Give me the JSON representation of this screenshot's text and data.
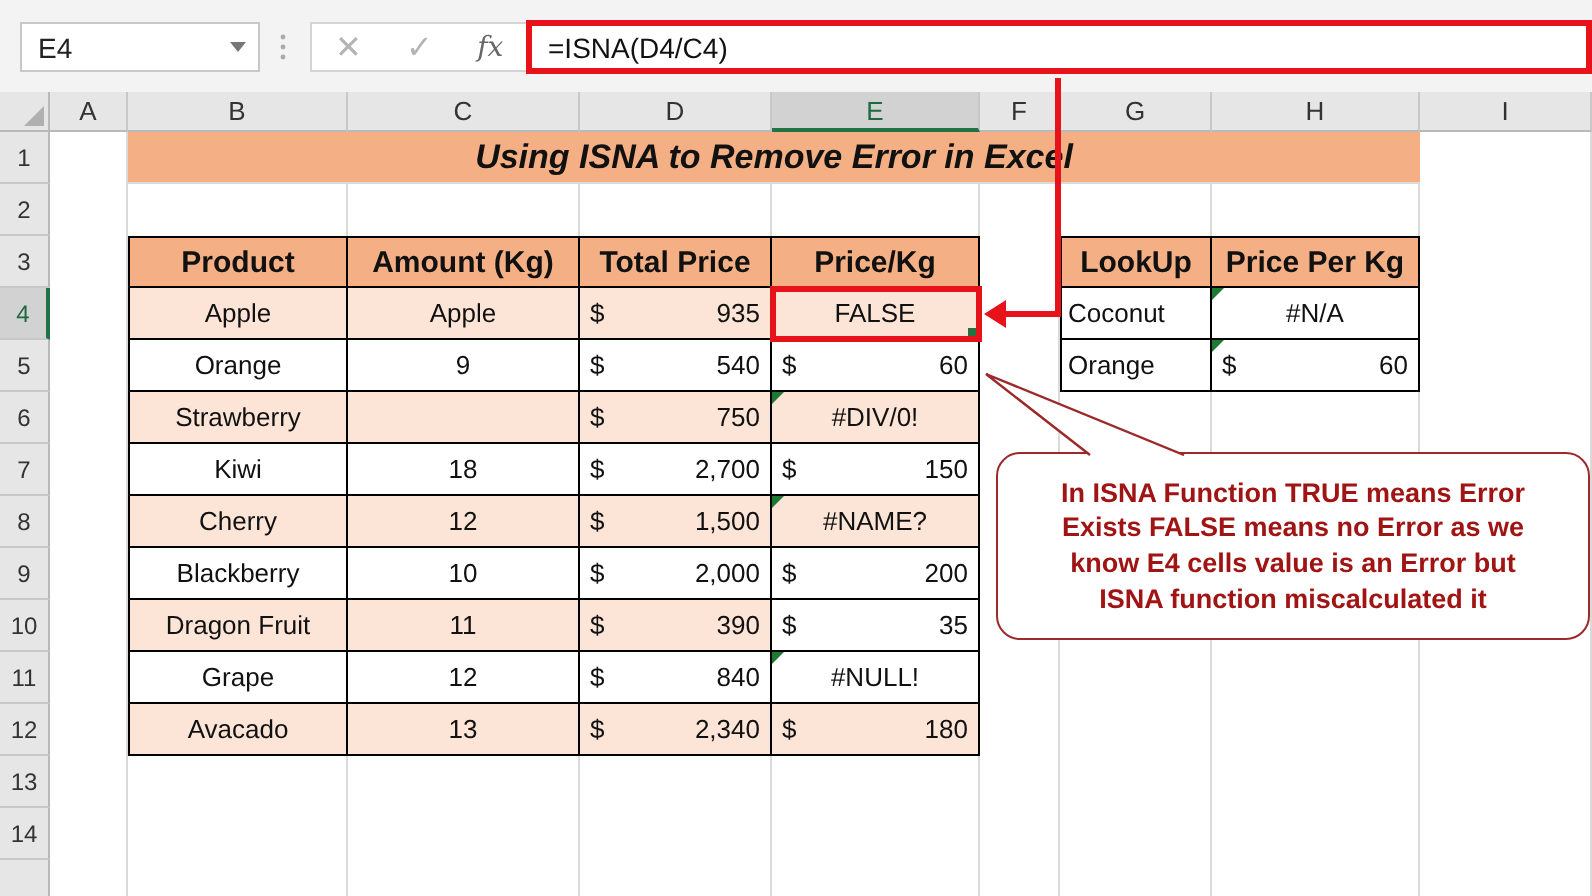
{
  "name_box": {
    "value": "E4"
  },
  "formula_bar": {
    "cancel": "✕",
    "enter": "✓",
    "function": "fx",
    "formula": "=ISNA(D4/C4)",
    "highlighted": true
  },
  "column_headers": [
    {
      "label": "A",
      "selected": false
    },
    {
      "label": "B",
      "selected": false
    },
    {
      "label": "C",
      "selected": false
    },
    {
      "label": "D",
      "selected": false
    },
    {
      "label": "E",
      "selected": true
    },
    {
      "label": "F",
      "selected": false
    },
    {
      "label": "G",
      "selected": false
    },
    {
      "label": "H",
      "selected": false
    },
    {
      "label": "I",
      "selected": false
    }
  ],
  "row_headers": [
    {
      "label": "1",
      "selected": false
    },
    {
      "label": "2",
      "selected": false
    },
    {
      "label": "3",
      "selected": false
    },
    {
      "label": "4",
      "selected": true
    },
    {
      "label": "5",
      "selected": false
    },
    {
      "label": "6",
      "selected": false
    },
    {
      "label": "7",
      "selected": false
    },
    {
      "label": "8",
      "selected": false
    },
    {
      "label": "9",
      "selected": false
    },
    {
      "label": "10",
      "selected": false
    },
    {
      "label": "11",
      "selected": false
    },
    {
      "label": "12",
      "selected": false
    },
    {
      "label": "13",
      "selected": false
    },
    {
      "label": "14",
      "selected": false
    }
  ],
  "title": "Using ISNA to Remove Error in Excel",
  "main_table": {
    "columns": [
      "Product",
      "Amount (Kg)",
      "Total Price",
      "Price/Kg"
    ],
    "rows": [
      {
        "cells": [
          {
            "kind": "text",
            "text": "Apple",
            "shaded": true,
            "flag": false,
            "selected": false
          },
          {
            "kind": "text",
            "text": "Apple",
            "shaded": true,
            "flag": false,
            "selected": false
          },
          {
            "kind": "currency",
            "symbol": "$",
            "text": "935",
            "shaded": true,
            "flag": false,
            "selected": false
          },
          {
            "kind": "text",
            "text": "FALSE",
            "shaded": true,
            "flag": false,
            "selected": true
          }
        ]
      },
      {
        "cells": [
          {
            "kind": "text",
            "text": "Orange",
            "shaded": false,
            "flag": false,
            "selected": false
          },
          {
            "kind": "text",
            "text": "9",
            "shaded": false,
            "flag": false,
            "selected": false
          },
          {
            "kind": "currency",
            "symbol": "$",
            "text": "540",
            "shaded": false,
            "flag": false,
            "selected": false
          },
          {
            "kind": "currency",
            "symbol": "$",
            "text": "60",
            "shaded": false,
            "flag": false,
            "selected": false
          }
        ]
      },
      {
        "cells": [
          {
            "kind": "text",
            "text": "Strawberry",
            "shaded": true,
            "flag": false,
            "selected": false
          },
          {
            "kind": "blank",
            "shaded": true,
            "flag": false,
            "selected": false
          },
          {
            "kind": "currency",
            "symbol": "$",
            "text": "750",
            "shaded": true,
            "flag": false,
            "selected": false
          },
          {
            "kind": "text",
            "text": "#DIV/0!",
            "shaded": true,
            "flag": true,
            "selected": false
          }
        ]
      },
      {
        "cells": [
          {
            "kind": "text",
            "text": "Kiwi",
            "shaded": false,
            "flag": false,
            "selected": false
          },
          {
            "kind": "text",
            "text": "18",
            "shaded": false,
            "flag": false,
            "selected": false
          },
          {
            "kind": "currency",
            "symbol": "$",
            "text": "2,700",
            "shaded": false,
            "flag": false,
            "selected": false
          },
          {
            "kind": "currency",
            "symbol": "$",
            "text": "150",
            "shaded": false,
            "flag": false,
            "selected": false
          }
        ]
      },
      {
        "cells": [
          {
            "kind": "text",
            "text": "Cherry",
            "shaded": true,
            "flag": false,
            "selected": false
          },
          {
            "kind": "text",
            "text": "12",
            "shaded": true,
            "flag": false,
            "selected": false
          },
          {
            "kind": "currency",
            "symbol": "$",
            "text": "1,500",
            "shaded": true,
            "flag": false,
            "selected": false
          },
          {
            "kind": "text",
            "text": "#NAME?",
            "shaded": true,
            "flag": true,
            "selected": false
          }
        ]
      },
      {
        "cells": [
          {
            "kind": "text",
            "text": "Blackberry",
            "shaded": false,
            "flag": false,
            "selected": false
          },
          {
            "kind": "text",
            "text": "10",
            "shaded": false,
            "flag": false,
            "selected": false
          },
          {
            "kind": "currency",
            "symbol": "$",
            "text": "2,000",
            "shaded": false,
            "flag": false,
            "selected": false
          },
          {
            "kind": "currency",
            "symbol": "$",
            "text": "200",
            "shaded": false,
            "flag": false,
            "selected": false
          }
        ]
      },
      {
        "cells": [
          {
            "kind": "text",
            "text": "Dragon Fruit",
            "shaded": true,
            "flag": false,
            "selected": false
          },
          {
            "kind": "text",
            "text": "11",
            "shaded": true,
            "flag": false,
            "selected": false
          },
          {
            "kind": "currency",
            "symbol": "$",
            "text": "390",
            "shaded": true,
            "flag": false,
            "selected": false
          },
          {
            "kind": "currency",
            "symbol": "$",
            "text": "35",
            "shaded": false,
            "flag": false,
            "selected": false
          }
        ]
      },
      {
        "cells": [
          {
            "kind": "text",
            "text": "Grape",
            "shaded": false,
            "flag": false,
            "selected": false
          },
          {
            "kind": "text",
            "text": "12",
            "shaded": false,
            "flag": false,
            "selected": false
          },
          {
            "kind": "currency",
            "symbol": "$",
            "text": "840",
            "shaded": false,
            "flag": false,
            "selected": false
          },
          {
            "kind": "text",
            "text": "#NULL!",
            "shaded": false,
            "flag": true,
            "selected": false
          }
        ]
      },
      {
        "cells": [
          {
            "kind": "text",
            "text": "Avacado",
            "shaded": true,
            "flag": false,
            "selected": false
          },
          {
            "kind": "text",
            "text": "13",
            "shaded": true,
            "flag": false,
            "selected": false
          },
          {
            "kind": "currency",
            "symbol": "$",
            "text": "2,340",
            "shaded": true,
            "flag": false,
            "selected": false
          },
          {
            "kind": "currency",
            "symbol": "$",
            "text": "180",
            "shaded": true,
            "flag": false,
            "selected": false
          }
        ]
      }
    ]
  },
  "lookup_table": {
    "columns": [
      "LookUp",
      "Price Per Kg"
    ],
    "rows": [
      {
        "cells": [
          {
            "kind": "label",
            "text": "Coconut",
            "shaded": false,
            "flag": false,
            "selected": false
          },
          {
            "kind": "text",
            "text": "#N/A",
            "shaded": false,
            "flag": true,
            "selected": false
          }
        ]
      },
      {
        "cells": [
          {
            "kind": "label",
            "text": "Orange",
            "shaded": false,
            "flag": false,
            "selected": false
          },
          {
            "kind": "currency",
            "symbol": "$",
            "text": "60",
            "shaded": false,
            "flag": true,
            "selected": false
          }
        ]
      }
    ]
  },
  "callout": {
    "text": "In ISNA Function TRUE means Error Exists FALSE means no Error as we know E4 cells value is an Error but ISNA function miscalculated it"
  }
}
